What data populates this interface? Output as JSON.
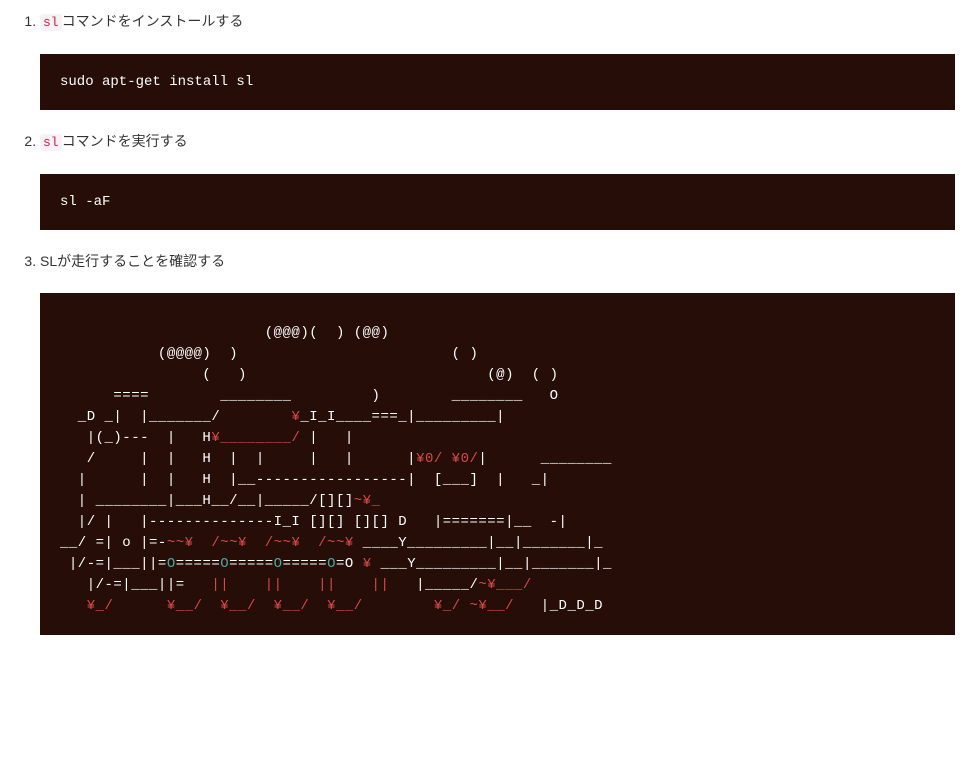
{
  "steps": [
    {
      "inline_code": "sl",
      "text_after": "コマンドをインストールする",
      "code": "sudo apt-get install sl"
    },
    {
      "inline_code": "sl",
      "text_after": "コマンドを実行する",
      "code": "sl -aF"
    },
    {
      "text_full": "SLが走行することを確認する"
    }
  ],
  "ascii": {
    "l01_a": "                       (@@@)(  ) (@@)",
    "l02_a": "           (@@@@)  )",
    "l02_b": "                        ( )",
    "l03_a": "                (   )",
    "l03_b": "                           (@)  ( )",
    "l04_a": "      ====        ________         )        ________   O",
    "l05_a": "  _D _|  |_______/        ",
    "l05_b": "¥",
    "l05_c": "_I_I____===_|_________|",
    "l06_a": "   |(_)---  |   H",
    "l06_b": "¥________/",
    "l06_c": " |   |",
    "l07_a": "   /     |  |   H  |  |     |   |      |",
    "l07_b": "¥0/ ¥0/",
    "l07_c": "|      ________",
    "l08_a": "  |      |  |   H  |__-----------------|  [___]  |   _|",
    "l09_a": "  | ________|___H__/__|_____/[][]",
    "l09_b": "~¥_",
    "l10_a": "  |/ |   |--------------I_I [][] [][] D   |=======|__  -|",
    "l11_a": "__/ =| o |=-",
    "l11_b": "~~¥  /~~¥  /~~¥  /~~¥",
    "l11_c": " ____Y_________|__|_______|_",
    "l12_a": " |/-=|___||=",
    "l12_b": "O",
    "l12_c": "=====",
    "l12_d": "O",
    "l12_e": "=====",
    "l12_f": "O",
    "l12_g": "=====",
    "l12_h": "O",
    "l12_i": "=O ",
    "l12_j": "¥",
    "l12_k": " ___Y_________|__|_______|_",
    "l13_a": "   |/-=|___||=   ",
    "l13_b": "||    ||    ||    ||",
    "l13_c": "   |_____/",
    "l13_d": "~¥___/",
    "l14_a": "   ",
    "l14_b": "¥_/",
    "l14_c": "      ",
    "l14_d": "¥__/  ¥__/  ¥__/  ¥__/",
    "l14_e": "        ",
    "l14_f": "¥_/ ~¥__/",
    "l14_g": "   |_D_D_D"
  }
}
